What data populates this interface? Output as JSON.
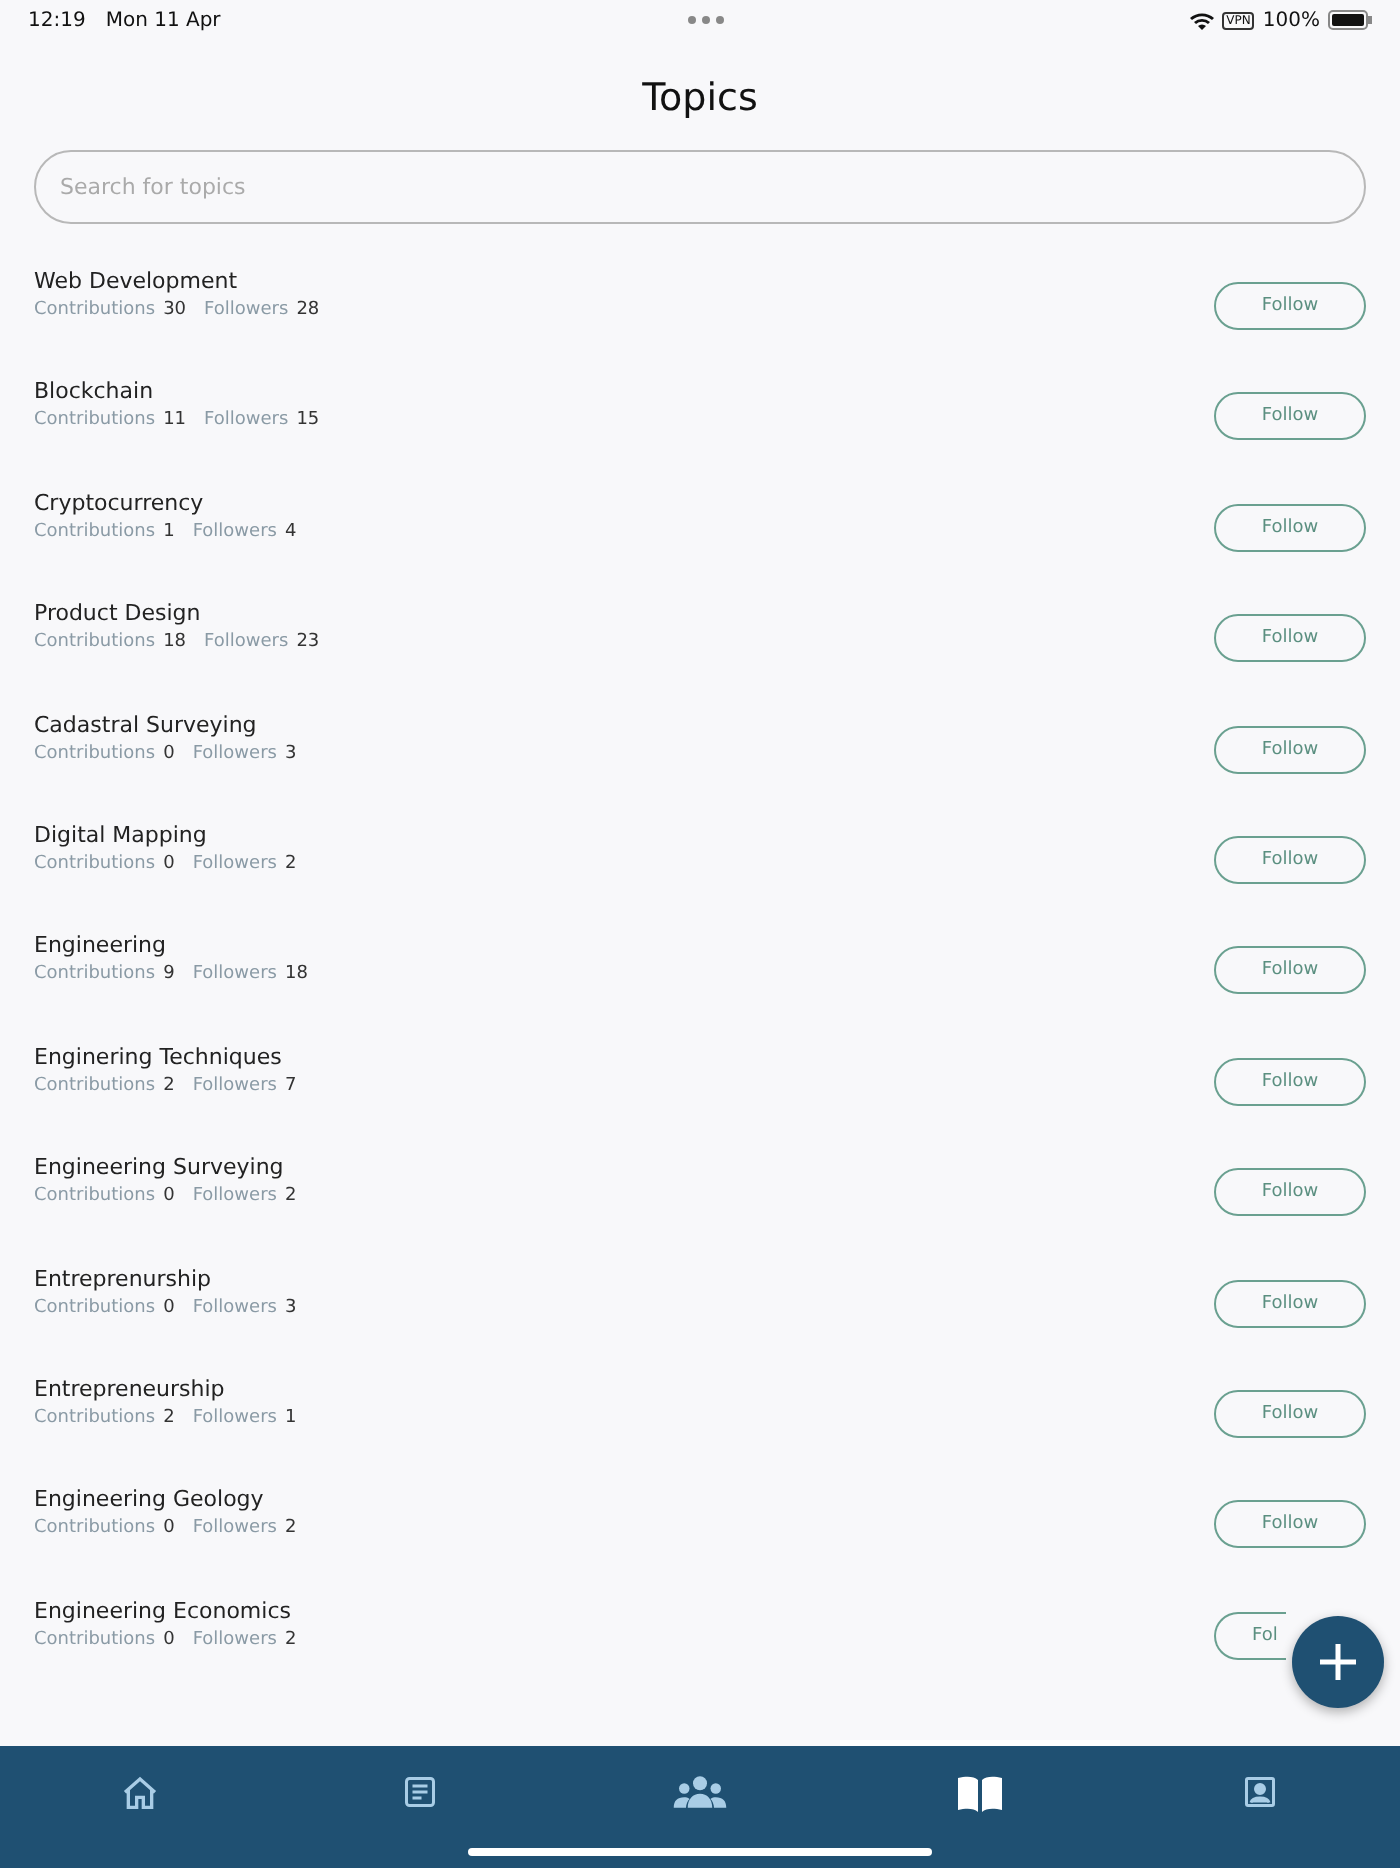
{
  "status_bar": {
    "time": "12:19",
    "date": "Mon 11 Apr",
    "vpn": "VPN",
    "battery": "100%"
  },
  "title": "Topics",
  "search": {
    "placeholder": "Search for topics"
  },
  "topics": [
    {
      "name": "Web Development",
      "contributions_label": "Contributions",
      "contributions": "30",
      "followers_label": "Followers",
      "followers": "28",
      "button": "Follow"
    },
    {
      "name": "Blockchain",
      "contributions_label": "Contributions",
      "contributions": "11",
      "followers_label": "Followers",
      "followers": "15",
      "button": "Follow"
    },
    {
      "name": "Cryptocurrency",
      "contributions_label": "Contributions",
      "contributions": "1",
      "followers_label": "Followers",
      "followers": "4",
      "button": "Follow"
    },
    {
      "name": "Product Design",
      "contributions_label": "Contributions",
      "contributions": "18",
      "followers_label": "Followers",
      "followers": "23",
      "button": "Follow"
    },
    {
      "name": "Cadastral Surveying",
      "contributions_label": "Contributions",
      "contributions": "0",
      "followers_label": "Followers",
      "followers": "3",
      "button": "Follow"
    },
    {
      "name": "Digital Mapping",
      "contributions_label": "Contributions",
      "contributions": "0",
      "followers_label": "Followers",
      "followers": "2",
      "button": "Follow"
    },
    {
      "name": "Engineering",
      "contributions_label": "Contributions",
      "contributions": "9",
      "followers_label": "Followers",
      "followers": "18",
      "button": "Follow"
    },
    {
      "name": "Enginering Techniques",
      "contributions_label": "Contributions",
      "contributions": "2",
      "followers_label": "Followers",
      "followers": "7",
      "button": "Follow"
    },
    {
      "name": "Engineering Surveying",
      "contributions_label": "Contributions",
      "contributions": "0",
      "followers_label": "Followers",
      "followers": "2",
      "button": "Follow"
    },
    {
      "name": "Entreprenurship",
      "contributions_label": "Contributions",
      "contributions": "0",
      "followers_label": "Followers",
      "followers": "3",
      "button": "Follow"
    },
    {
      "name": "Entrepreneurship",
      "contributions_label": "Contributions",
      "contributions": "2",
      "followers_label": "Followers",
      "followers": "1",
      "button": "Follow"
    },
    {
      "name": "Engineering Geology",
      "contributions_label": "Contributions",
      "contributions": "0",
      "followers_label": "Followers",
      "followers": "2",
      "button": "Follow"
    },
    {
      "name": "Engineering Economics",
      "contributions_label": "Contributions",
      "contributions": "0",
      "followers_label": "Followers",
      "followers": "2",
      "button": "Fol"
    }
  ],
  "tabs": [
    {
      "kind": "home",
      "selected": false
    },
    {
      "kind": "feed",
      "selected": false
    },
    {
      "kind": "community",
      "selected": false
    },
    {
      "kind": "topics",
      "selected": true
    },
    {
      "kind": "profile",
      "selected": false
    }
  ]
}
